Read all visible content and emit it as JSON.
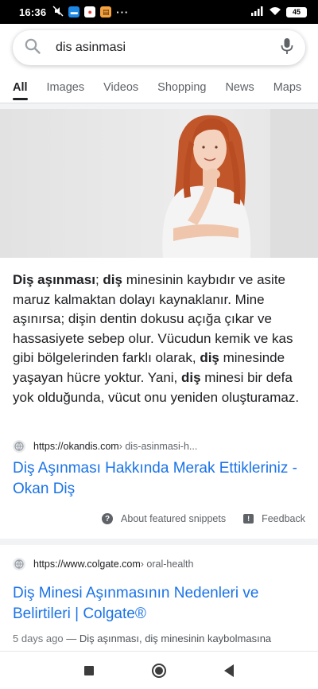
{
  "status_bar": {
    "time": "16:36",
    "overflow": "···",
    "battery": "45",
    "icons": [
      "mute-icon",
      "messages-icon",
      "app-icon",
      "notification-icon",
      "signal-icon",
      "wifi-icon",
      "battery-icon"
    ]
  },
  "search": {
    "query": "dis asinmasi"
  },
  "tabs": [
    "All",
    "Images",
    "Videos",
    "Shopping",
    "News",
    "Maps"
  ],
  "featured": {
    "text_parts": [
      {
        "t": "Diş aşınması",
        "b": true
      },
      {
        "t": "; ",
        "b": false
      },
      {
        "t": "diş",
        "b": true
      },
      {
        "t": " minesinin kaybıdır ve asite maruz kalmaktan dolayı kaynaklanır. Mine aşınırsa; dişin dentin dokusu açığa çıkar ve hassasiyete sebep olur. Vücudun kemik ve kas gibi bölgelerinden farklı olarak, ",
        "b": false
      },
      {
        "t": "diş",
        "b": true
      },
      {
        "t": " minesinde yaşayan hücre yoktur. Yani, ",
        "b": false
      },
      {
        "t": "diş",
        "b": true
      },
      {
        "t": " minesi bir defa yok olduğunda, vücut onu yeniden oluşturamaz.",
        "b": false
      }
    ],
    "source_domain": "https://okandis.com",
    "source_path": " › dis-asinmasi-h...",
    "title": "Diş Aşınması Hakkında Merak Ettikleriniz - Okan Diş",
    "about_label": "About featured snippets",
    "feedback_label": "Feedback"
  },
  "result2": {
    "source_domain": "https://www.colgate.com",
    "source_path": " › oral-health",
    "title": "Diş Minesi Aşınmasının Nedenleri ve Belirtileri | Colgate®",
    "date": "5 days ago",
    "snippet": " — Diş aşınması, diş minesinin kaybolmasına"
  },
  "colors": {
    "link_blue": "#1a73e8",
    "text": "#202124",
    "muted": "#5f6368"
  }
}
